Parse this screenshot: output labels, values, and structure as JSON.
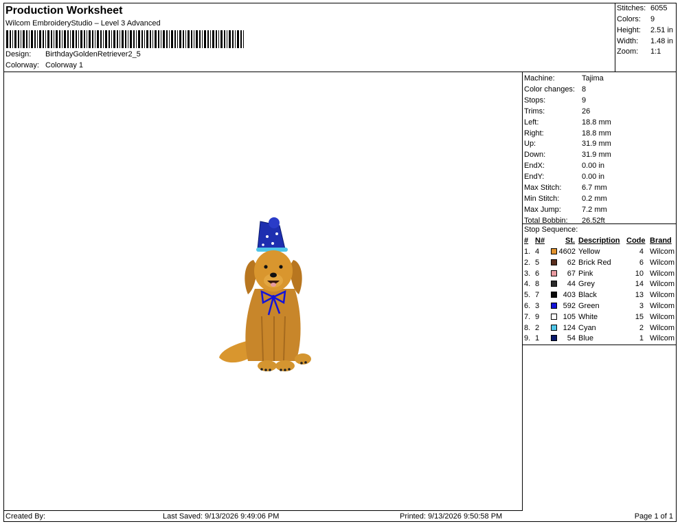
{
  "header": {
    "title": "Production Worksheet",
    "subtitle": "Wilcom EmbroideryStudio – Level 3 Advanced",
    "design_label": "Design:",
    "design_value": "BirthdayGoldenRetriever2_5",
    "colorway_label": "Colorway:",
    "colorway_value": "Colorway 1"
  },
  "summary": {
    "stitches_label": "Stitches:",
    "stitches": "6055",
    "colors_label": "Colors:",
    "colors": "9",
    "height_label": "Height:",
    "height": "2.51 in",
    "width_label": "Width:",
    "width": "1.48 in",
    "zoom_label": "Zoom:",
    "zoom": "1:1"
  },
  "machine_info": [
    {
      "label": "Machine:",
      "value": "Tajima"
    },
    {
      "label": "Color changes:",
      "value": "8"
    },
    {
      "label": "Stops:",
      "value": "9"
    },
    {
      "label": "Trims:",
      "value": "26"
    },
    {
      "label": "Left:",
      "value": "18.8 mm"
    },
    {
      "label": "Right:",
      "value": "18.8 mm"
    },
    {
      "label": "Up:",
      "value": "31.9 mm"
    },
    {
      "label": "Down:",
      "value": "31.9 mm"
    },
    {
      "label": "EndX:",
      "value": "0.00 in"
    },
    {
      "label": "EndY:",
      "value": "0.00 in"
    },
    {
      "label": "Max Stitch:",
      "value": "6.7 mm"
    },
    {
      "label": "Min Stitch:",
      "value": "0.2 mm"
    },
    {
      "label": "Max Jump:",
      "value": "7.2 mm"
    },
    {
      "label": "Total Bobbin:",
      "value": "26.52ft"
    }
  ],
  "stop_sequence": {
    "title": "Stop Sequence:",
    "headers": {
      "num": "#",
      "n": "N#",
      "st": "St.",
      "desc": "Description",
      "code": "Code",
      "brand": "Brand"
    },
    "rows": [
      {
        "num": "1.",
        "n": "4",
        "color": "#E0922E",
        "st": "4602",
        "desc": "Yellow",
        "code": "4",
        "brand": "Wilcom"
      },
      {
        "num": "2.",
        "n": "5",
        "color": "#5A2E1E",
        "st": "62",
        "desc": "Brick Red",
        "code": "6",
        "brand": "Wilcom"
      },
      {
        "num": "3.",
        "n": "6",
        "color": "#E89AA0",
        "st": "67",
        "desc": "Pink",
        "code": "10",
        "brand": "Wilcom"
      },
      {
        "num": "4.",
        "n": "8",
        "color": "#2A2A2A",
        "st": "44",
        "desc": "Grey",
        "code": "14",
        "brand": "Wilcom"
      },
      {
        "num": "5.",
        "n": "7",
        "color": "#0A0A0A",
        "st": "403",
        "desc": "Black",
        "code": "13",
        "brand": "Wilcom"
      },
      {
        "num": "6.",
        "n": "3",
        "color": "#1414D8",
        "st": "592",
        "desc": "Green",
        "code": "3",
        "brand": "Wilcom"
      },
      {
        "num": "7.",
        "n": "9",
        "color": "#FFFFFF",
        "st": "105",
        "desc": "White",
        "code": "15",
        "brand": "Wilcom"
      },
      {
        "num": "8.",
        "n": "2",
        "color": "#4FC6E8",
        "st": "124",
        "desc": "Cyan",
        "code": "2",
        "brand": "Wilcom"
      },
      {
        "num": "9.",
        "n": "1",
        "color": "#0A1A6E",
        "st": "54",
        "desc": "Blue",
        "code": "1",
        "brand": "Wilcom"
      }
    ]
  },
  "footer": {
    "created_by": "Created By:",
    "last_saved": "Last Saved: 9/13/2026 9:49:06 PM",
    "printed": "Printed: 9/13/2026 9:50:58 PM",
    "page": "Page 1 of 1"
  }
}
